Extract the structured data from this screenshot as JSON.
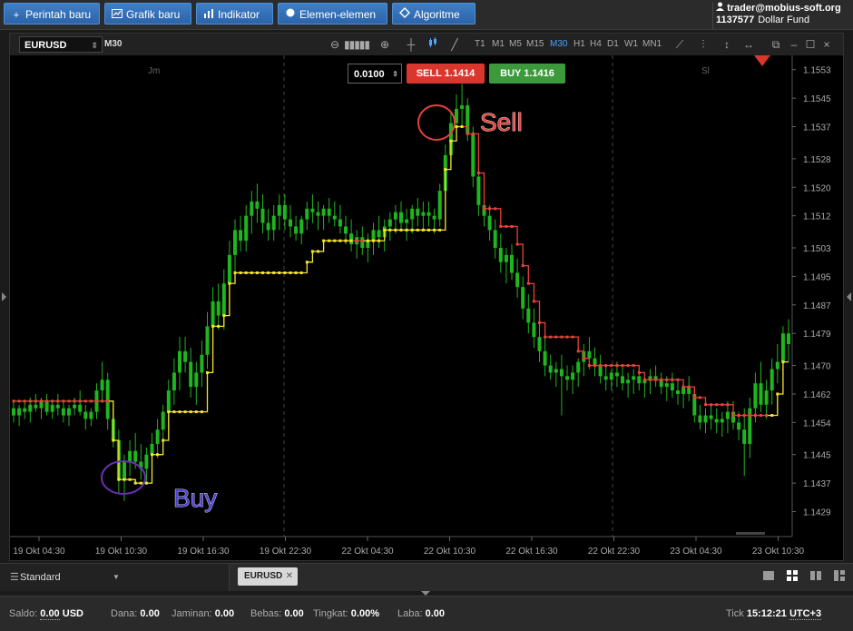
{
  "toolbar": {
    "buttons": [
      {
        "icon": "plus-icon",
        "glyph": "+",
        "label": "Perintah baru"
      },
      {
        "icon": "chart-icon",
        "glyph": "📈",
        "label": "Grafik baru"
      },
      {
        "icon": "indicator-icon",
        "glyph": "▮",
        "label": "Indikator"
      },
      {
        "icon": "elements-icon",
        "glyph": "●",
        "label": "Elemen-elemen"
      },
      {
        "icon": "algorithm-icon",
        "glyph": "◇",
        "label": "Algoritme"
      }
    ]
  },
  "account": {
    "email": "trader@mobius-soft.org",
    "number": "1137577",
    "fund": "Dollar Fund"
  },
  "chart_window": {
    "symbol": "EURUSD",
    "current_timeframe": "M30",
    "timeframes": [
      "T1",
      "M1",
      "M5",
      "M15",
      "M30",
      "H1",
      "H4",
      "D1",
      "W1",
      "MN1"
    ],
    "active_timeframe": "M30",
    "order": {
      "quantity": "0.0100",
      "sell_label": "SELL 1.1414",
      "buy_label": "BUY 1.1416"
    }
  },
  "chart_data": {
    "type": "candlestick",
    "session_labels": [
      "Jm",
      "Sl"
    ],
    "annotations": [
      {
        "text": "Sell",
        "color": "#e8413b"
      },
      {
        "text": "Buy",
        "color": "#4a3fd6"
      }
    ],
    "y_ticks": [
      "1.1553",
      "1.1545",
      "1.1537",
      "1.1528",
      "1.1520",
      "1.1512",
      "1.1503",
      "1.1495",
      "1.1487",
      "1.1479",
      "1.1470",
      "1.1462",
      "1.1454",
      "1.1445",
      "1.1437",
      "1.1429"
    ],
    "ylim": [
      1.1422,
      1.1557
    ],
    "x_ticks": [
      "19 Okt 04:30",
      "19 Okt 10:30",
      "19 Okt 16:30",
      "19 Okt 22:30",
      "22 Okt 04:30",
      "22 Okt 10:30",
      "22 Okt 16:30",
      "22 Okt 22:30",
      "23 Okt 04:30",
      "23 Okt 10:30"
    ],
    "candles": [
      [
        1.1458,
        1.146,
        1.1454,
        1.1456
      ],
      [
        1.1456,
        1.1459,
        1.1453,
        1.1458
      ],
      [
        1.1458,
        1.146,
        1.1455,
        1.1457
      ],
      [
        1.1457,
        1.1461,
        1.1454,
        1.1459
      ],
      [
        1.1459,
        1.1462,
        1.1457,
        1.1458
      ],
      [
        1.1458,
        1.1461,
        1.1455,
        1.146
      ],
      [
        1.146,
        1.1462,
        1.1456,
        1.1457
      ],
      [
        1.1457,
        1.146,
        1.1455,
        1.1459
      ],
      [
        1.1459,
        1.1462,
        1.1456,
        1.1458
      ],
      [
        1.1458,
        1.146,
        1.1454,
        1.1456
      ],
      [
        1.1456,
        1.1459,
        1.1453,
        1.1458
      ],
      [
        1.1458,
        1.1461,
        1.1456,
        1.1459
      ],
      [
        1.1459,
        1.1463,
        1.1456,
        1.1457
      ],
      [
        1.1457,
        1.1459,
        1.1452,
        1.1455
      ],
      [
        1.1455,
        1.1458,
        1.1453,
        1.1457
      ],
      [
        1.1457,
        1.1465,
        1.1455,
        1.1463
      ],
      [
        1.1463,
        1.1471,
        1.146,
        1.1466
      ],
      [
        1.1466,
        1.1468,
        1.1452,
        1.1455
      ],
      [
        1.1455,
        1.1458,
        1.1447,
        1.1449
      ],
      [
        1.1449,
        1.1452,
        1.1434,
        1.1438
      ],
      [
        1.1438,
        1.1445,
        1.1432,
        1.1443
      ],
      [
        1.1443,
        1.1449,
        1.1439,
        1.1446
      ],
      [
        1.1446,
        1.1451,
        1.1441,
        1.1443
      ],
      [
        1.1443,
        1.1448,
        1.1438,
        1.1441
      ],
      [
        1.1441,
        1.1447,
        1.1437,
        1.1445
      ],
      [
        1.1445,
        1.1451,
        1.144,
        1.1448
      ],
      [
        1.1448,
        1.1455,
        1.1444,
        1.1452
      ],
      [
        1.1452,
        1.1459,
        1.1448,
        1.1457
      ],
      [
        1.1457,
        1.1466,
        1.1453,
        1.1463
      ],
      [
        1.1463,
        1.1472,
        1.1459,
        1.1468
      ],
      [
        1.1468,
        1.1478,
        1.1463,
        1.1474
      ],
      [
        1.1474,
        1.1478,
        1.1468,
        1.1471
      ],
      [
        1.1471,
        1.1475,
        1.1461,
        1.1464
      ],
      [
        1.1464,
        1.1471,
        1.1459,
        1.1468
      ],
      [
        1.1468,
        1.1477,
        1.1464,
        1.1473
      ],
      [
        1.1473,
        1.1485,
        1.1469,
        1.1481
      ],
      [
        1.1481,
        1.1492,
        1.1476,
        1.1488
      ],
      [
        1.1488,
        1.1493,
        1.148,
        1.1484
      ],
      [
        1.1484,
        1.1497,
        1.148,
        1.1493
      ],
      [
        1.1493,
        1.1505,
        1.1488,
        1.1501
      ],
      [
        1.1501,
        1.1511,
        1.1496,
        1.1508
      ],
      [
        1.1508,
        1.1512,
        1.1502,
        1.1505
      ],
      [
        1.1505,
        1.1515,
        1.1502,
        1.1512
      ],
      [
        1.1512,
        1.1519,
        1.1507,
        1.1516
      ],
      [
        1.1516,
        1.1521,
        1.151,
        1.1514
      ],
      [
        1.1514,
        1.1518,
        1.1507,
        1.151
      ],
      [
        1.151,
        1.1514,
        1.1505,
        1.1508
      ],
      [
        1.1508,
        1.1515,
        1.1505,
        1.1512
      ],
      [
        1.1512,
        1.1518,
        1.1508,
        1.1515
      ],
      [
        1.1515,
        1.1518,
        1.1508,
        1.1511
      ],
      [
        1.1511,
        1.1515,
        1.1506,
        1.1509
      ],
      [
        1.1509,
        1.1512,
        1.1505,
        1.1507
      ],
      [
        1.1507,
        1.1512,
        1.1504,
        1.1511
      ],
      [
        1.1511,
        1.1516,
        1.1508,
        1.1514
      ],
      [
        1.1514,
        1.1518,
        1.151,
        1.1513
      ],
      [
        1.1513,
        1.1516,
        1.1508,
        1.1512
      ],
      [
        1.1512,
        1.1515,
        1.1508,
        1.1514
      ],
      [
        1.1514,
        1.1517,
        1.151,
        1.1512
      ],
      [
        1.1512,
        1.1516,
        1.1509,
        1.1511
      ],
      [
        1.1511,
        1.1515,
        1.1507,
        1.1509
      ],
      [
        1.1509,
        1.1512,
        1.1504,
        1.1507
      ],
      [
        1.1507,
        1.1511,
        1.1502,
        1.1504
      ],
      [
        1.1504,
        1.1508,
        1.15,
        1.1506
      ],
      [
        1.1506,
        1.1509,
        1.1501,
        1.1503
      ],
      [
        1.1503,
        1.1507,
        1.1499,
        1.1505
      ],
      [
        1.1505,
        1.151,
        1.1501,
        1.1508
      ],
      [
        1.1508,
        1.1512,
        1.1503,
        1.1506
      ],
      [
        1.1506,
        1.1511,
        1.1502,
        1.1509
      ],
      [
        1.1509,
        1.1513,
        1.1505,
        1.1511
      ],
      [
        1.1511,
        1.1515,
        1.1507,
        1.1513
      ],
      [
        1.1513,
        1.1516,
        1.1508,
        1.151
      ],
      [
        1.151,
        1.1514,
        1.1505,
        1.1511
      ],
      [
        1.1511,
        1.1515,
        1.1507,
        1.1514
      ],
      [
        1.1514,
        1.1517,
        1.1509,
        1.1512
      ],
      [
        1.1512,
        1.1516,
        1.1508,
        1.1513
      ],
      [
        1.1513,
        1.1516,
        1.1509,
        1.1512
      ],
      [
        1.1512,
        1.1514,
        1.1507,
        1.1511
      ],
      [
        1.1511,
        1.1521,
        1.1509,
        1.1519
      ],
      [
        1.1519,
        1.1532,
        1.1516,
        1.1529
      ],
      [
        1.1529,
        1.1541,
        1.1525,
        1.1538
      ],
      [
        1.1538,
        1.1546,
        1.1533,
        1.1542
      ],
      [
        1.1542,
        1.1549,
        1.1537,
        1.1543
      ],
      [
        1.1543,
        1.1545,
        1.1533,
        1.1535
      ],
      [
        1.1535,
        1.1537,
        1.152,
        1.1523
      ],
      [
        1.1523,
        1.1527,
        1.1512,
        1.1515
      ],
      [
        1.1515,
        1.1519,
        1.1509,
        1.1512
      ],
      [
        1.1512,
        1.1515,
        1.1505,
        1.1508
      ],
      [
        1.1508,
        1.1511,
        1.15,
        1.1503
      ],
      [
        1.1503,
        1.1507,
        1.1496,
        1.1499
      ],
      [
        1.1499,
        1.1503,
        1.1493,
        1.1501
      ],
      [
        1.1501,
        1.1504,
        1.1494,
        1.1496
      ],
      [
        1.1496,
        1.15,
        1.1489,
        1.1492
      ],
      [
        1.1492,
        1.1495,
        1.1483,
        1.1486
      ],
      [
        1.1486,
        1.149,
        1.1479,
        1.1482
      ],
      [
        1.1482,
        1.1486,
        1.1475,
        1.1478
      ],
      [
        1.1478,
        1.1482,
        1.1471,
        1.1474
      ],
      [
        1.1474,
        1.1478,
        1.1467,
        1.147
      ],
      [
        1.147,
        1.1473,
        1.1466,
        1.1468
      ],
      [
        1.1468,
        1.1471,
        1.1464,
        1.1469
      ],
      [
        1.1469,
        1.1473,
        1.1456,
        1.1467
      ],
      [
        1.1467,
        1.147,
        1.1463,
        1.1466
      ],
      [
        1.1466,
        1.147,
        1.1462,
        1.1468
      ],
      [
        1.1468,
        1.1472,
        1.1464,
        1.1471
      ],
      [
        1.1471,
        1.1476,
        1.1467,
        1.1474
      ],
      [
        1.1474,
        1.1478,
        1.1469,
        1.1472
      ],
      [
        1.1472,
        1.1475,
        1.1467,
        1.147
      ],
      [
        1.147,
        1.1473,
        1.1465,
        1.1467
      ],
      [
        1.1467,
        1.147,
        1.1463,
        1.1466
      ],
      [
        1.1466,
        1.1469,
        1.1463,
        1.1468
      ],
      [
        1.1468,
        1.1471,
        1.1464,
        1.1467
      ],
      [
        1.1467,
        1.147,
        1.1463,
        1.1465
      ],
      [
        1.1465,
        1.1468,
        1.1461,
        1.1466
      ],
      [
        1.1466,
        1.1469,
        1.1462,
        1.1467
      ],
      [
        1.1467,
        1.147,
        1.1463,
        1.1465
      ],
      [
        1.1465,
        1.1468,
        1.1461,
        1.1466
      ],
      [
        1.1466,
        1.1469,
        1.1462,
        1.1467
      ],
      [
        1.1467,
        1.147,
        1.1464,
        1.1466
      ],
      [
        1.1466,
        1.1468,
        1.1462,
        1.1464
      ],
      [
        1.1464,
        1.1467,
        1.146,
        1.1465
      ],
      [
        1.1465,
        1.1468,
        1.1461,
        1.1463
      ],
      [
        1.1463,
        1.1466,
        1.1459,
        1.1462
      ],
      [
        1.1462,
        1.1465,
        1.1458,
        1.1464
      ],
      [
        1.1464,
        1.1467,
        1.146,
        1.1462
      ],
      [
        1.1462,
        1.1464,
        1.1454,
        1.1456
      ],
      [
        1.1456,
        1.1459,
        1.1452,
        1.1454
      ],
      [
        1.1454,
        1.1458,
        1.1451,
        1.1456
      ],
      [
        1.1456,
        1.1459,
        1.1452,
        1.1455
      ],
      [
        1.1455,
        1.1458,
        1.1451,
        1.1454
      ],
      [
        1.1454,
        1.1457,
        1.145,
        1.1455
      ],
      [
        1.1455,
        1.146,
        1.1451,
        1.1457
      ],
      [
        1.1457,
        1.146,
        1.1452,
        1.1454
      ],
      [
        1.1454,
        1.1457,
        1.1449,
        1.1452
      ],
      [
        1.1452,
        1.1458,
        1.1439,
        1.1448
      ],
      [
        1.1448,
        1.1461,
        1.1444,
        1.1458
      ],
      [
        1.1458,
        1.1468,
        1.1454,
        1.1465
      ],
      [
        1.1465,
        1.1471,
        1.1457,
        1.1459
      ],
      [
        1.1459,
        1.1466,
        1.1455,
        1.1463
      ],
      [
        1.1463,
        1.1472,
        1.1459,
        1.1469
      ],
      [
        1.1469,
        1.1476,
        1.1465,
        1.1471
      ],
      [
        1.1471,
        1.1481,
        1.1467,
        1.1479
      ],
      [
        1.1479,
        1.1483,
        1.1471,
        1.1476
      ]
    ],
    "stop_line": [
      1.146,
      1.146,
      1.146,
      1.146,
      1.146,
      1.146,
      1.146,
      1.146,
      1.146,
      1.146,
      1.146,
      1.146,
      1.146,
      1.146,
      1.146,
      1.146,
      1.146,
      1.146,
      1.1449,
      1.1438,
      1.1438,
      1.1438,
      1.1437,
      1.1437,
      1.1437,
      1.1445,
      1.1445,
      1.1449,
      1.1457,
      1.1457,
      1.1457,
      1.1457,
      1.1457,
      1.1457,
      1.1457,
      1.1468,
      1.1481,
      1.1481,
      1.1484,
      1.1493,
      1.1496,
      1.1496,
      1.1496,
      1.1496,
      1.1496,
      1.1496,
      1.1496,
      1.1496,
      1.1496,
      1.1496,
      1.1496,
      1.1496,
      1.1496,
      1.1499,
      1.1502,
      1.1502,
      1.1505,
      1.1505,
      1.1505,
      1.1505,
      1.1505,
      1.1505,
      1.1505,
      1.1505,
      1.1505,
      1.1505,
      1.1505,
      1.1508,
      1.1508,
      1.1508,
      1.1508,
      1.1508,
      1.1508,
      1.1508,
      1.1508,
      1.1508,
      1.1508,
      1.1508,
      1.1525,
      1.1533,
      1.1537,
      1.1537,
      1.1535,
      1.1535,
      1.1524,
      1.1514,
      1.1514,
      1.1514,
      1.1509,
      1.1509,
      1.1509,
      1.1504,
      1.1498,
      1.1493,
      1.1488,
      1.1482,
      1.1478,
      1.1478,
      1.1478,
      1.1478,
      1.1478,
      1.1478,
      1.1474,
      1.1472,
      1.147,
      1.147,
      1.147,
      1.147,
      1.147,
      1.147,
      1.147,
      1.147,
      1.147,
      1.1468,
      1.1466,
      1.1466,
      1.1466,
      1.1466,
      1.1466,
      1.1466,
      1.1466,
      1.1464,
      1.1464,
      1.1461,
      1.1461,
      1.1459,
      1.1459,
      1.1459,
      1.1459,
      1.1459,
      1.1456,
      1.1456,
      1.1456,
      1.1456,
      1.1456,
      1.1456,
      1.1456,
      1.1456,
      1.1462,
      1.1471
    ],
    "stop_color": [
      "#e8413b",
      "#e8413b",
      "#e8413b",
      "#e8413b",
      "#e8413b",
      "#e8413b",
      "#e8413b",
      "#e8413b",
      "#e8413b",
      "#e8413b",
      "#e8413b",
      "#e8413b",
      "#e8413b",
      "#e8413b",
      "#e8413b",
      "#e8413b",
      "#e8413b",
      "#e8413b",
      "#f5e52c",
      "#f5e52c",
      "#f5e52c",
      "#f5e52c",
      "#f5e52c",
      "#f5e52c",
      "#f5e52c",
      "#f5e52c",
      "#f5e52c",
      "#f5e52c",
      "#f5e52c",
      "#f5e52c",
      "#f5e52c",
      "#f5e52c",
      "#f5e52c",
      "#f5e52c",
      "#f5e52c",
      "#f5e52c",
      "#f5e52c",
      "#f5e52c",
      "#f5e52c",
      "#f5e52c",
      "#f5e52c",
      "#f5e52c",
      "#f5e52c",
      "#f5e52c",
      "#f5e52c",
      "#f5e52c",
      "#f5e52c",
      "#f5e52c",
      "#f5e52c",
      "#f5e52c",
      "#f5e52c",
      "#f5e52c",
      "#f5e52c",
      "#f5e52c",
      "#f5e52c",
      "#f5e52c",
      "#f5e52c",
      "#f5e52c",
      "#f5e52c",
      "#f5e52c",
      "#f5e52c",
      "#f5e52c",
      "#e8413b",
      "#e8413b",
      "#f5e52c",
      "#f5e52c",
      "#f5e52c",
      "#f5e52c",
      "#f5e52c",
      "#f5e52c",
      "#f5e52c",
      "#f5e52c",
      "#f5e52c",
      "#f5e52c",
      "#f5e52c",
      "#f5e52c",
      "#f5e52c",
      "#f5e52c",
      "#f5e52c",
      "#f5e52c",
      "#f5e52c",
      "#f5e52c",
      "#e8413b",
      "#e8413b",
      "#e8413b",
      "#e8413b",
      "#e8413b",
      "#e8413b",
      "#e8413b",
      "#e8413b",
      "#e8413b",
      "#e8413b",
      "#e8413b",
      "#e8413b",
      "#e8413b",
      "#e8413b",
      "#e8413b",
      "#e8413b",
      "#e8413b",
      "#e8413b",
      "#e8413b",
      "#e8413b",
      "#e8413b",
      "#e8413b",
      "#e8413b",
      "#e8413b",
      "#e8413b",
      "#e8413b",
      "#e8413b",
      "#e8413b",
      "#e8413b",
      "#e8413b",
      "#e8413b",
      "#e8413b",
      "#e8413b",
      "#e8413b",
      "#e8413b",
      "#e8413b",
      "#e8413b",
      "#e8413b",
      "#e8413b",
      "#e8413b",
      "#e8413b",
      "#e8413b",
      "#e8413b",
      "#e8413b",
      "#e8413b",
      "#e8413b",
      "#e8413b",
      "#e8413b",
      "#e8413b",
      "#e8413b",
      "#e8413b",
      "#e8413b",
      "#e8413b",
      "#e8413b",
      "#e8413b",
      "#f5e52c",
      "#f5e52c",
      "#f5e52c",
      "#f5e52c",
      "#f5e52c",
      "#f5e52c"
    ],
    "up_color": "#1fb51f",
    "down_color": "#1fb51f",
    "background": "#000000"
  },
  "tabs": {
    "layout_name": "Standard",
    "symbol_tab": "EURUSD"
  },
  "status": {
    "saldo_label": "Saldo:",
    "saldo_value": "0.00",
    "saldo_ccy": "USD",
    "dana_label": "Dana:",
    "dana_value": "0.00",
    "jaminan_label": "Jaminan:",
    "jaminan_value": "0.00",
    "bebas_label": "Bebas:",
    "bebas_value": "0.00",
    "tingkat_label": "Tingkat:",
    "tingkat_value": "0.00%",
    "laba_label": "Laba:",
    "laba_value": "0.00",
    "tick_label": "Tick",
    "time": "15:12:21",
    "tz": "UTC+3"
  }
}
